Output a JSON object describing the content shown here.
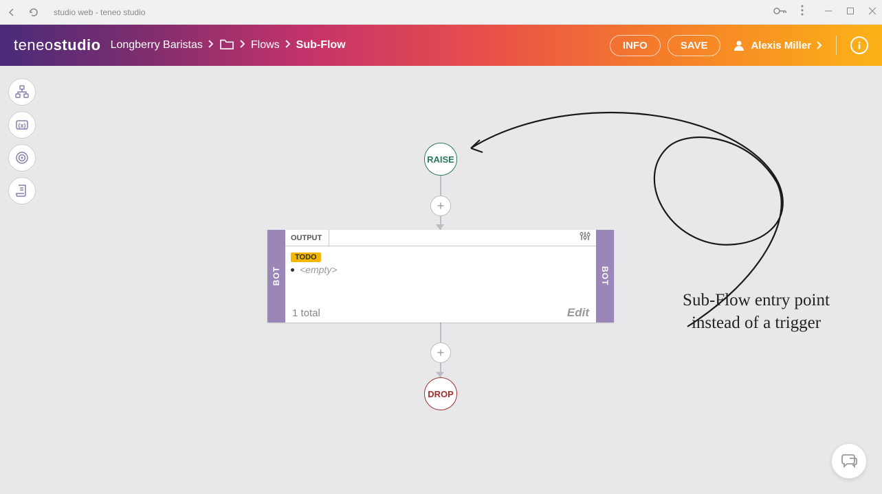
{
  "chrome": {
    "title": "studio web - teneo studio"
  },
  "header": {
    "logo_light": "teneo",
    "logo_bold": "studio",
    "breadcrumb": {
      "project": "Longberry Baristas",
      "section": "Flows",
      "current": "Sub-Flow"
    },
    "info_btn": "INFO",
    "save_btn": "SAVE",
    "user": "Alexis Miller"
  },
  "flow": {
    "raise": "RAISE",
    "drop": "DROP",
    "output_box": {
      "header": "OUTPUT",
      "side_left": "BOT",
      "side_right": "BOT",
      "todo": "TODO",
      "empty": "<empty>",
      "footer_total": "1 total",
      "edit": "Edit"
    }
  },
  "annotation": "Sub-Flow entry point instead of a trigger"
}
